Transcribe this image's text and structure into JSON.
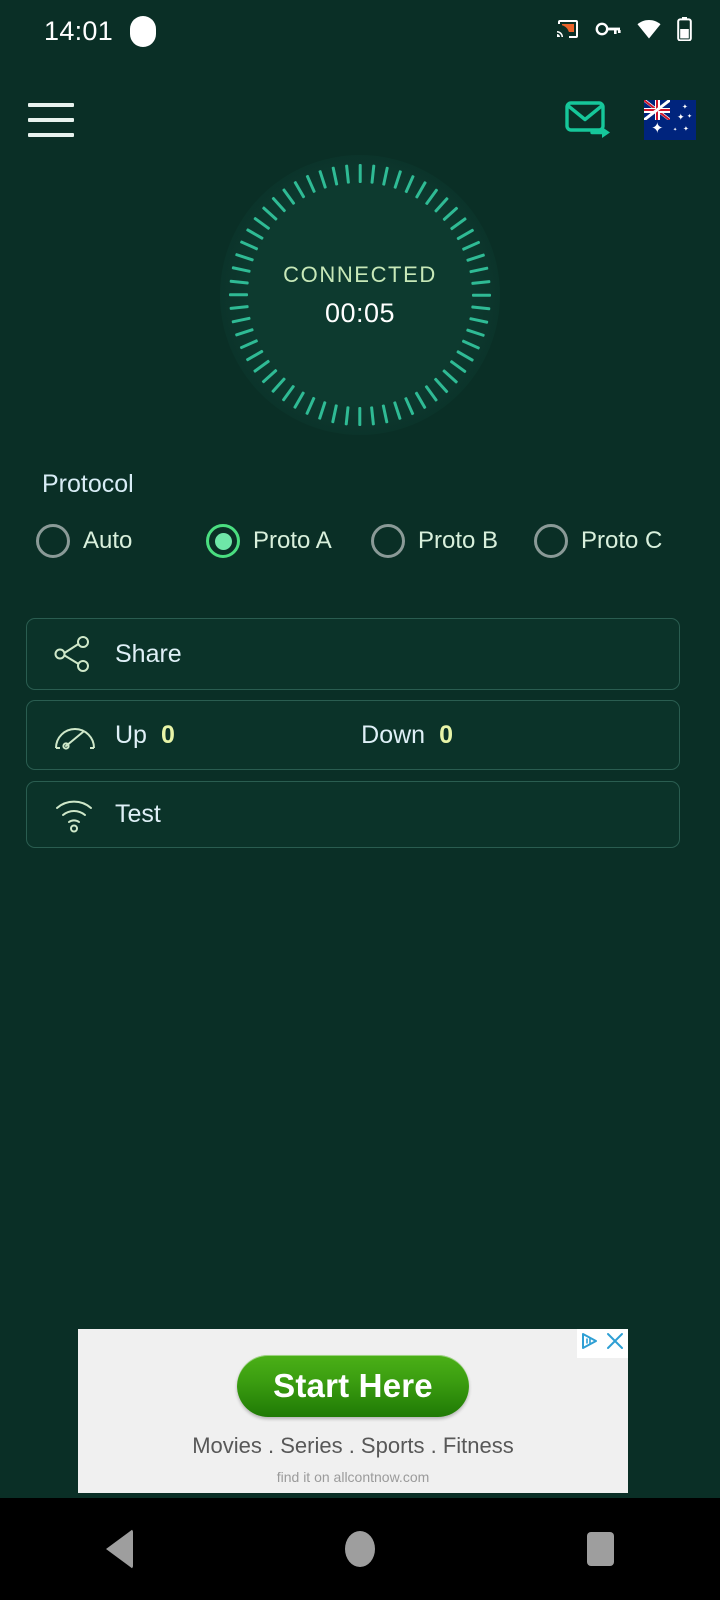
{
  "status_bar": {
    "time": "14:01",
    "icons": [
      "camera-dot-icon",
      "cast-icon",
      "vpn-key-icon",
      "wifi-icon",
      "battery-icon"
    ]
  },
  "header": {
    "menu_icon": "hamburger-menu-icon",
    "mail_forward_icon": "mail-forward-icon",
    "flag_icon": "australia-flag-icon",
    "flag_country": "Australia"
  },
  "dial": {
    "status": "CONNECTED",
    "timer": "00:05",
    "tick_count": 60,
    "tick_color": "#2fbb95",
    "status_color": "#c7e8b8",
    "timer_color": "#ffffff"
  },
  "protocol": {
    "title": "Protocol",
    "selected": "Proto A",
    "options": [
      {
        "label": "Auto",
        "checked": false
      },
      {
        "label": "Proto A",
        "checked": true
      },
      {
        "label": "Proto B",
        "checked": false
      },
      {
        "label": "Proto C",
        "checked": false
      }
    ],
    "accent_color": "#4ade80",
    "inactive_color": "#8a9a97"
  },
  "actions": {
    "share": {
      "label": "Share",
      "icon": "share-nodes-icon"
    },
    "speed": {
      "icon": "speedometer-icon",
      "up_label": "Up",
      "up_value": "0",
      "down_label": "Down",
      "down_value": "0",
      "value_color": "#e8f5a8"
    },
    "test": {
      "label": "Test",
      "icon": "wifi-signal-icon"
    }
  },
  "ad": {
    "button_label": "Start Here",
    "categories": "Movies  .  Series  .  Sports  .  Fitness",
    "url_text": "find it on allcontnow.com",
    "adchoices_icon": "adchoices-icon",
    "close_icon": "close-icon",
    "button_color": "#3a9c10"
  },
  "navbar": {
    "back_icon": "back-triangle-icon",
    "home_icon": "home-circle-icon",
    "recents_icon": "recents-square-icon"
  },
  "theme": {
    "background": "#0a2f26",
    "card_background": "#0b3329",
    "card_border": "#2a5d50"
  }
}
